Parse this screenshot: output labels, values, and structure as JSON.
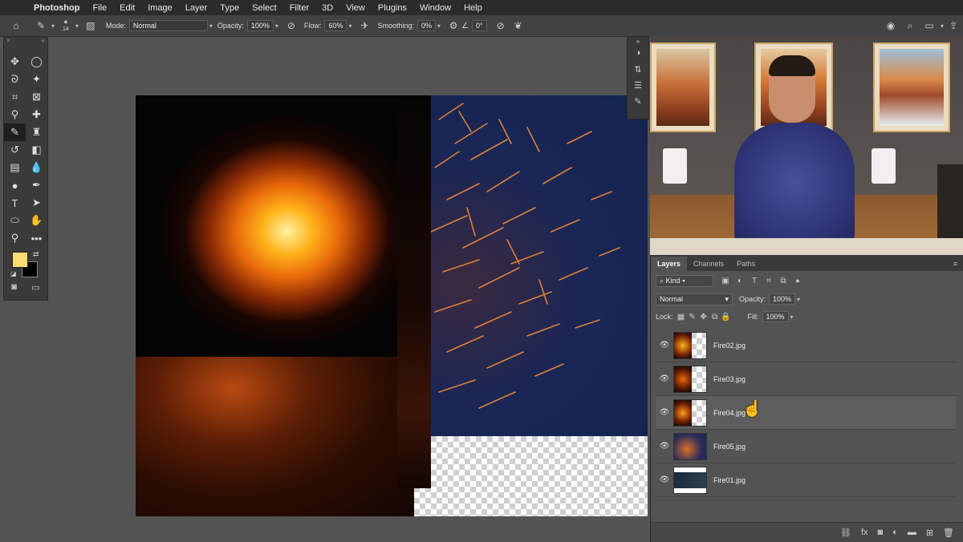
{
  "menu": {
    "items": [
      "Photoshop",
      "File",
      "Edit",
      "Image",
      "Layer",
      "Type",
      "Select",
      "Filter",
      "3D",
      "View",
      "Plugins",
      "Window",
      "Help"
    ]
  },
  "options": {
    "brush_size": "14",
    "mode_label": "Mode:",
    "mode_value": "Normal",
    "opacity_label": "Opacity:",
    "opacity_value": "100%",
    "flow_label": "Flow:",
    "flow_value": "60%",
    "smoothing_label": "Smoothing:",
    "smoothing_value": "0%",
    "angle_value": "0°"
  },
  "colors": {
    "foreground": "#f7dd6e",
    "background": "#000000",
    "accent": "#3a3a3a"
  },
  "layers_panel": {
    "tabs": [
      "Layers",
      "Channels",
      "Paths"
    ],
    "filter_label": "Kind",
    "blend_mode": "Normal",
    "opacity_label": "Opacity:",
    "opacity_value": "100%",
    "lock_label": "Lock:",
    "fill_label": "Fill:",
    "fill_value": "100%",
    "layers": [
      {
        "name": "Fire02.jpg",
        "visible": true
      },
      {
        "name": "Fire03.jpg",
        "visible": true
      },
      {
        "name": "Fire04.jpg",
        "visible": true
      },
      {
        "name": "Fire05.jpg",
        "visible": true
      },
      {
        "name": "Fire01.jpg",
        "visible": true
      }
    ]
  }
}
